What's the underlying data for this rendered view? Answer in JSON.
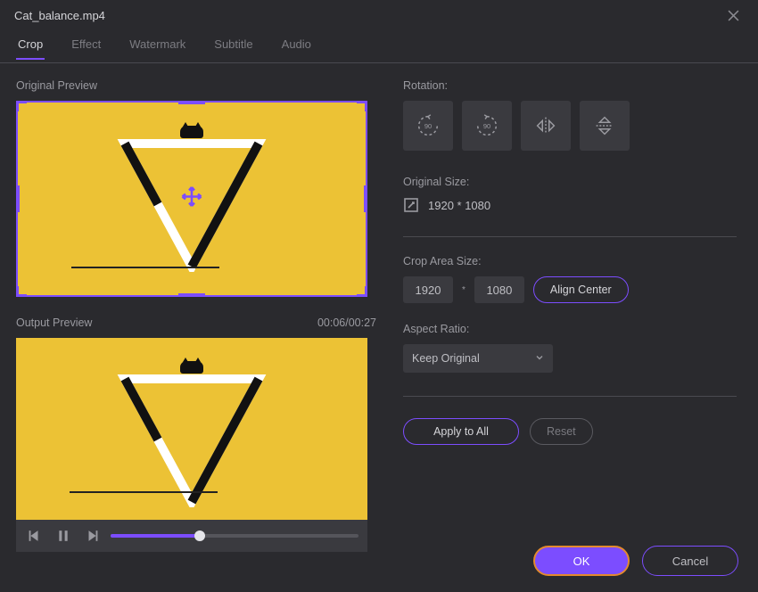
{
  "title": "Cat_balance.mp4",
  "tabs": [
    "Crop",
    "Effect",
    "Watermark",
    "Subtitle",
    "Audio"
  ],
  "active_tab": 0,
  "left": {
    "original_label": "Original Preview",
    "output_label": "Output Preview",
    "timecode": "00:06/00:27"
  },
  "right": {
    "rotation_label": "Rotation:",
    "original_size_label": "Original Size:",
    "original_size_value": "1920 * 1080",
    "crop_area_label": "Crop Area Size:",
    "crop_w": "1920",
    "crop_h": "1080",
    "align_center": "Align Center",
    "aspect_label": "Aspect Ratio:",
    "aspect_value": "Keep Original",
    "apply_all": "Apply to All",
    "reset": "Reset"
  },
  "footer": {
    "ok": "OK",
    "cancel": "Cancel"
  },
  "icons": {
    "rot_ccw": "rotate-ccw-icon",
    "rot_cw": "rotate-cw-icon",
    "flip_h": "flip-horizontal-icon",
    "flip_v": "flip-vertical-icon"
  }
}
